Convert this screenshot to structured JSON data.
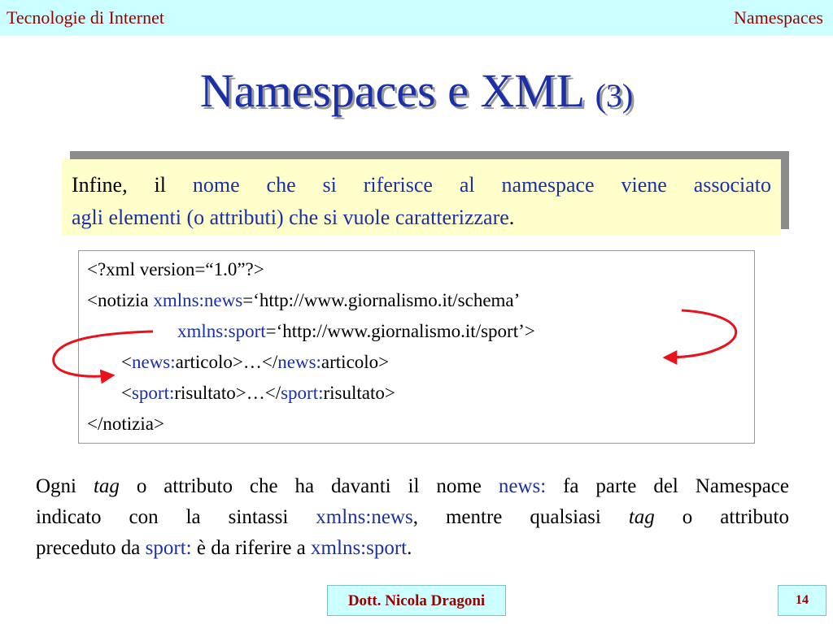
{
  "header": {
    "left": "Tecnologie di Internet",
    "right": "Namespaces"
  },
  "title": {
    "main": "Namespaces e XML",
    "number": "(3)"
  },
  "callout": {
    "t1": "Infine, il ",
    "t2": "nome che si riferisce al namespace viene associato",
    "t3": "agli elementi (o attributi) che si vuole caratterizzare",
    "t4": "."
  },
  "code": {
    "l1": "<?xml version=“1.0”?>",
    "l2a": "<notizia ",
    "l2b": "xmlns:news",
    "l2c": "=‘http://www.giornalismo.it/schema’",
    "l3a": "xmlns:sport",
    "l3b": "=‘http://www.giornalismo.it/sport’>",
    "l4a": "<",
    "l4b": "news:",
    "l4c": "articolo>…</",
    "l4d": "news:",
    "l4e": "articolo>",
    "l5a": "<",
    "l5b": "sport:",
    "l5c": "risultato>…</",
    "l5d": "sport:",
    "l5e": "risultato>",
    "l6": "</notizia>"
  },
  "paragraph": {
    "p1": "Ogni ",
    "p2": "tag",
    "p3": " o attributo che ha davanti il nome ",
    "p4": "news:",
    "p5": " fa parte del Namespace",
    "p6": "indicato con la sintassi ",
    "p7": "xmlns:news",
    "p8": ", mentre qualsiasi ",
    "p9": "tag",
    "p10": " o attributo",
    "p11": "preceduto da ",
    "p12": "sport:",
    "p13": " è da riferire a ",
    "p14": "xmlns:sport",
    "p15": "."
  },
  "footer": {
    "author": "Dott. Nicola Dragoni",
    "page": "14"
  },
  "colors": {
    "header_bg": "#ccffff",
    "header_text": "#990000",
    "title": "#1b2fa6",
    "highlight": "#1b2fa6",
    "callout_bg": "#ffffcc",
    "arrow": "#e8121c"
  }
}
